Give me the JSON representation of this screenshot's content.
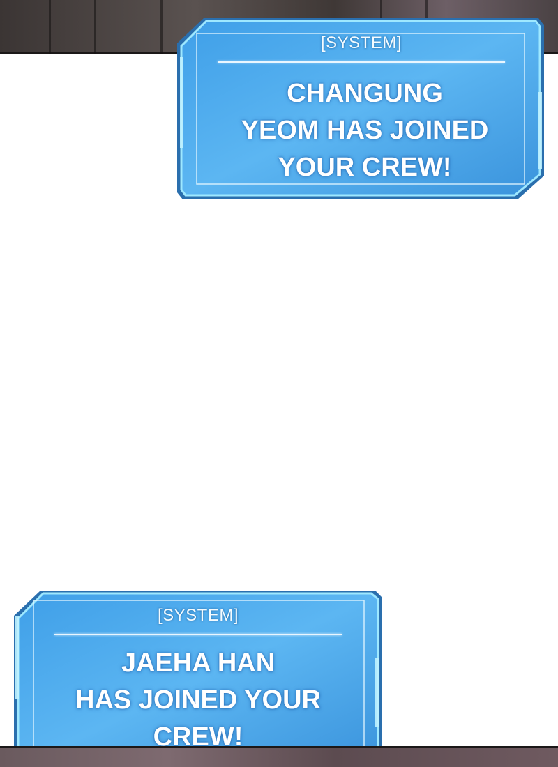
{
  "notifications": [
    {
      "tag": "[SYSTEM]",
      "message": "CHANGUNG\nYEOM HAS JOINED\nYOUR CREW!"
    },
    {
      "tag": "[SYSTEM]",
      "message": "JAEHA HAN\nHAS JOINED YOUR\nCREW!"
    }
  ],
  "colors": {
    "box_fill": "#4aa9ef",
    "box_border": "#8fe3ff",
    "page_bg": "#ffffff"
  }
}
